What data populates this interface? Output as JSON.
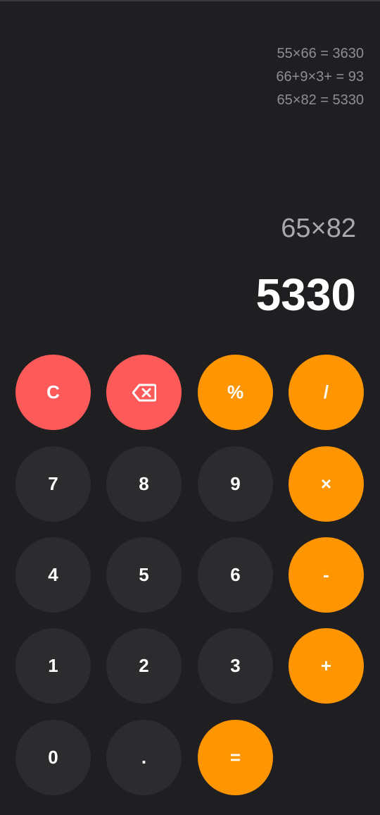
{
  "history": [
    "55×66 = 3630",
    "66+9×3+ = 93",
    "65×82 = 5330"
  ],
  "display": {
    "expression": "65×82",
    "result": "5330"
  },
  "keys": {
    "clear": "C",
    "backspace_icon": "backspace-icon",
    "percent": "%",
    "divide": "/",
    "seven": "7",
    "eight": "8",
    "nine": "9",
    "multiply": "×",
    "four": "4",
    "five": "5",
    "six": "6",
    "minus": "-",
    "one": "1",
    "two": "2",
    "three": "3",
    "plus": "+",
    "zero": "0",
    "dot": ".",
    "equals": "="
  },
  "colors": {
    "background": "#1f1f21",
    "digit_key": "#2c2c2e",
    "operator_key": "#ff9500",
    "danger_key": "#ff5a5a"
  }
}
